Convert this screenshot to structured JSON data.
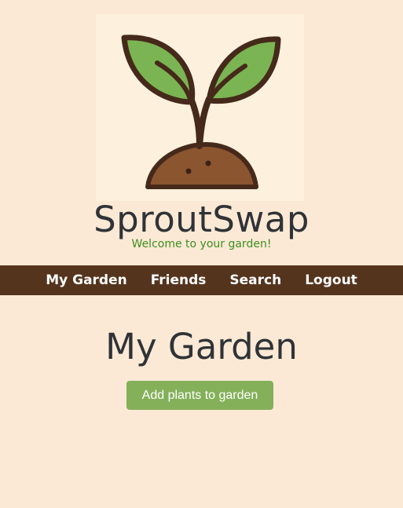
{
  "header": {
    "logo_icon": "sprout-logo-icon",
    "site_name": "SproutSwap",
    "tagline": "Welcome to your garden!"
  },
  "nav": {
    "items": [
      {
        "label": "My Garden"
      },
      {
        "label": "Friends"
      },
      {
        "label": "Search"
      },
      {
        "label": "Logout"
      }
    ]
  },
  "main": {
    "heading": "My Garden",
    "add_button_label": "Add plants to garden"
  },
  "colors": {
    "background": "#fbe9d5",
    "navbar": "#55341e",
    "title_text": "#2f3337",
    "tagline_text": "#3e8e1e",
    "button": "#84b05a",
    "leaf": "#7bb452",
    "soil": "#8b5530"
  }
}
